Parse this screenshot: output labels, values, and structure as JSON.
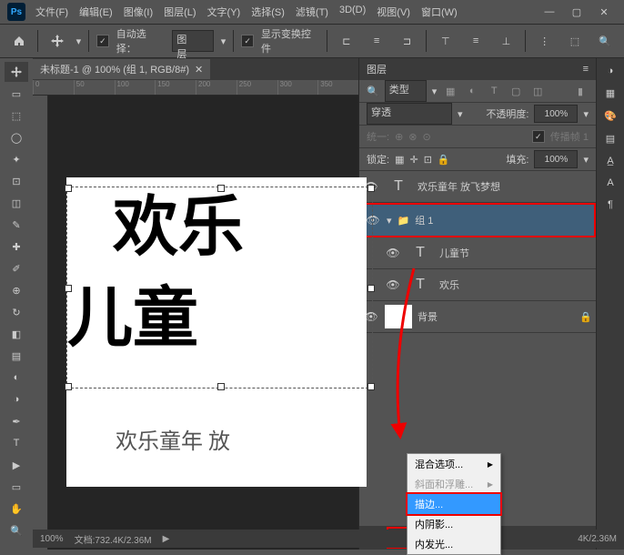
{
  "menubar": [
    "文件(F)",
    "编辑(E)",
    "图像(I)",
    "图层(L)",
    "文字(Y)",
    "选择(S)",
    "滤镜(T)",
    "3D(D)",
    "视图(V)",
    "窗口(W)"
  ],
  "optbar": {
    "auto_select": "自动选择：",
    "auto_select_target": "图层",
    "show_transform": "显示变换控件"
  },
  "doc_tab": "未标题-1 @ 100% (组 1, RGB/8#)",
  "ruler_ticks": [
    "0",
    "50",
    "100",
    "150",
    "200",
    "250",
    "300",
    "350"
  ],
  "canvas_text": {
    "line1": "欢乐",
    "line2": "儿童",
    "sub": "欢乐童年 放"
  },
  "panel": {
    "title": "图层",
    "filter_kind": "类型",
    "blend": "穿透",
    "opacity_label": "不透明度:",
    "opacity": "100%",
    "unify": "统一:",
    "propagate": "传播帧 1",
    "lock": "锁定:",
    "fill_label": "填充:",
    "fill": "100%"
  },
  "layers": [
    {
      "type": "T",
      "name": "欢乐童年 放飞梦想",
      "indent": 0
    },
    {
      "type": "group",
      "name": "组 1",
      "indent": 0,
      "highlight": true
    },
    {
      "type": "T",
      "name": "儿童节",
      "indent": 1
    },
    {
      "type": "T",
      "name": "欢乐",
      "indent": 1
    },
    {
      "type": "bg",
      "name": "背景",
      "indent": 0,
      "locked": true
    }
  ],
  "fx_menu": [
    "混合选项...",
    "斜面和浮雕...",
    "描边...",
    "内阴影...",
    "内发光..."
  ],
  "fx_hover_index": 2,
  "fx_disabled": [
    1
  ],
  "status": {
    "zoom": "100%",
    "doc": "文档:",
    "size": "732.4K/2.36M",
    "size2": "4K/2.36M"
  }
}
